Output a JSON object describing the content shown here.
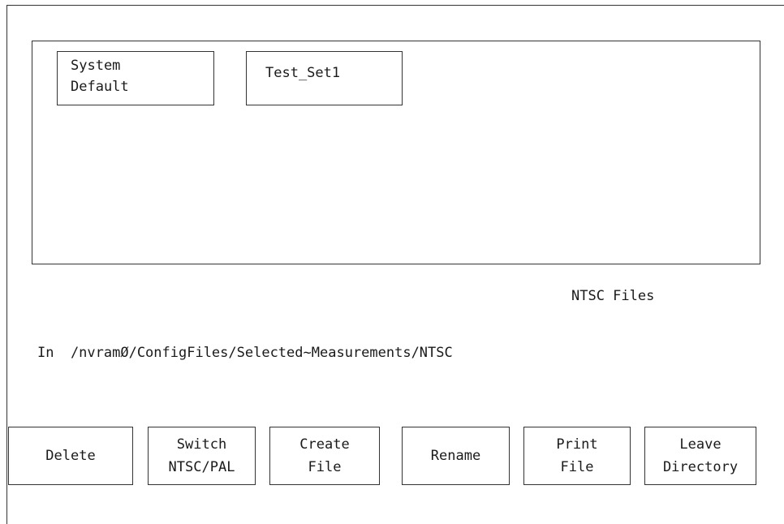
{
  "file_list": {
    "items": [
      {
        "label": "System\nDefault"
      },
      {
        "label": "Test_Set1"
      }
    ]
  },
  "files_label": "NTSC Files",
  "path": {
    "text": "In  /nvramØ/ConfigFiles/Selected~Measurements/NTSC"
  },
  "softkeys": [
    {
      "line1": "Delete",
      "line2": ""
    },
    {
      "line1": "Switch",
      "line2": "NTSC/PAL"
    },
    {
      "line1": "Create",
      "line2": "File"
    },
    {
      "line1": "Rename",
      "line2": ""
    },
    {
      "line1": "Print",
      "line2": "File"
    },
    {
      "line1": "Leave",
      "line2": "Directory"
    }
  ]
}
